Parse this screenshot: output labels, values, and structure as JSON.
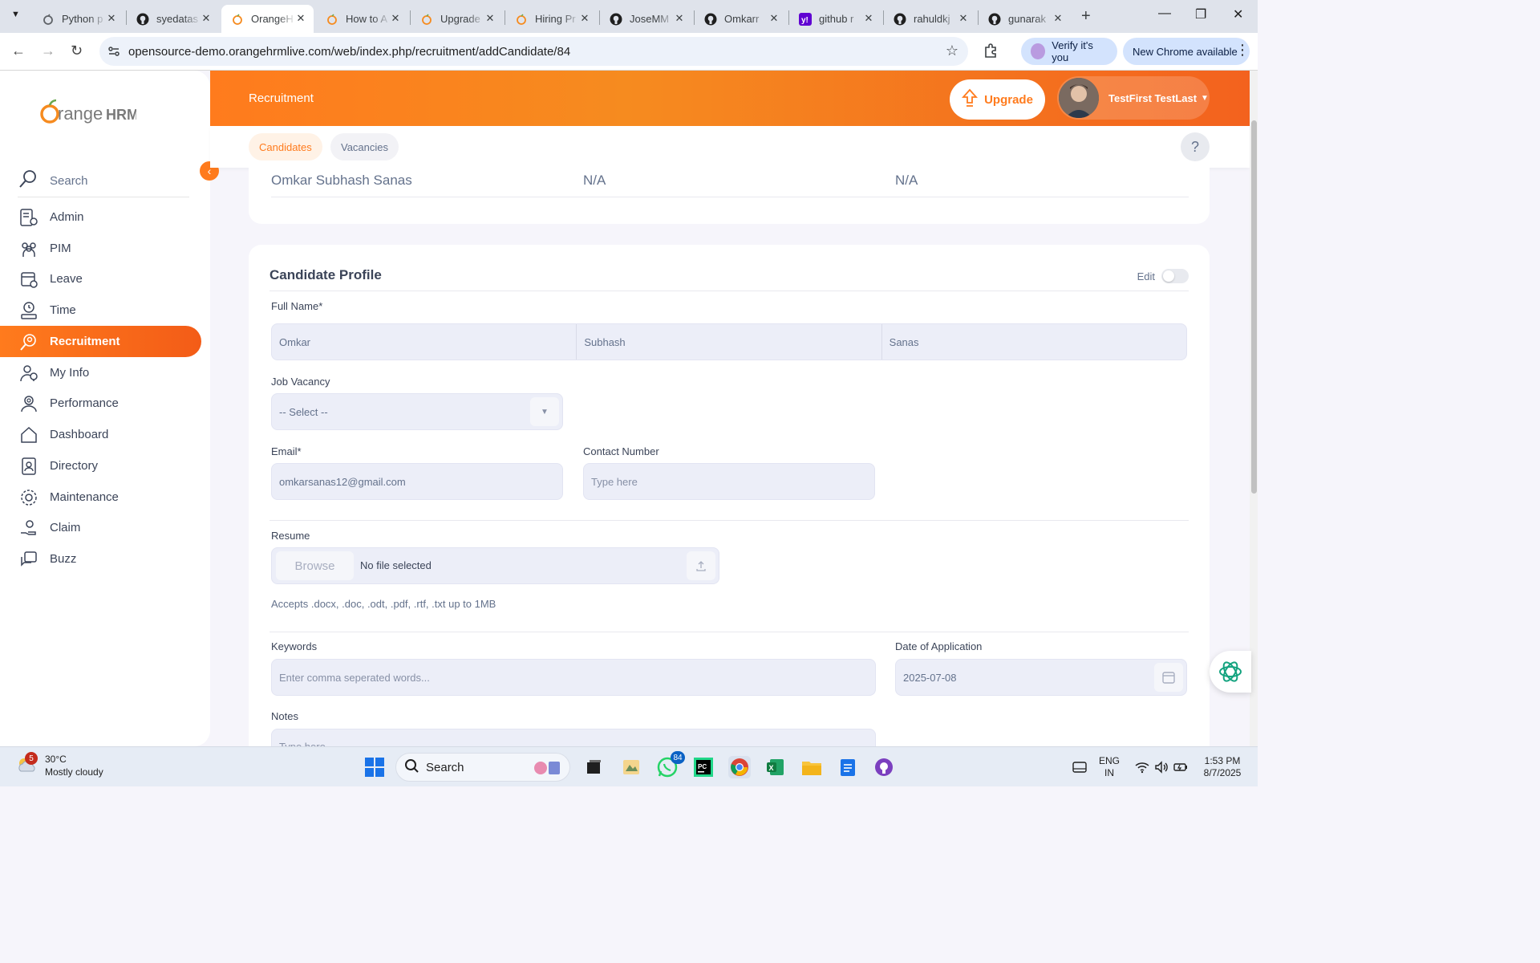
{
  "browser": {
    "tabs": [
      {
        "label": "Python p",
        "icon": "orangehrm-icon"
      },
      {
        "label": "syedatas",
        "icon": "github-icon"
      },
      {
        "label": "OrangeH",
        "icon": "orangehrm-icon",
        "active": true
      },
      {
        "label": "How to A",
        "icon": "orangehrm-icon"
      },
      {
        "label": "Upgrade",
        "icon": "orangehrm-icon"
      },
      {
        "label": "Hiring Pr",
        "icon": "orangehrm-icon"
      },
      {
        "label": "JoseMM",
        "icon": "github-icon"
      },
      {
        "label": "Omkarr",
        "icon": "github-icon"
      },
      {
        "label": "github r",
        "icon": "yahoo-icon"
      },
      {
        "label": "rahuldkj",
        "icon": "github-icon"
      },
      {
        "label": "gunarak",
        "icon": "github-icon"
      }
    ],
    "url": "opensource-demo.orangehrmlive.com/web/index.php/recruitment/addCandidate/84",
    "verify_label": "Verify it's you",
    "update_label": "New Chrome available"
  },
  "header": {
    "title": "Recruitment",
    "upgrade_label": "Upgrade",
    "user_name": "TestFirst TestLast"
  },
  "subnav": {
    "tabs": [
      "Candidates",
      "Vacancies"
    ],
    "help": "?"
  },
  "sidebar": {
    "search_label": "Search",
    "items": [
      {
        "label": "Admin",
        "icon": "admin-icon"
      },
      {
        "label": "PIM",
        "icon": "pim-icon"
      },
      {
        "label": "Leave",
        "icon": "leave-icon"
      },
      {
        "label": "Time",
        "icon": "time-icon"
      },
      {
        "label": "Recruitment",
        "icon": "recruitment-icon",
        "active": true
      },
      {
        "label": "My Info",
        "icon": "my-info-icon"
      },
      {
        "label": "Performance",
        "icon": "performance-icon"
      },
      {
        "label": "Dashboard",
        "icon": "dashboard-icon"
      },
      {
        "label": "Directory",
        "icon": "directory-icon"
      },
      {
        "label": "Maintenance",
        "icon": "maintenance-icon"
      },
      {
        "label": "Claim",
        "icon": "claim-icon"
      },
      {
        "label": "Buzz",
        "icon": "buzz-icon"
      }
    ]
  },
  "application_row": {
    "name": "Omkar Subhash Sanas",
    "col2": "N/A",
    "col3": "N/A"
  },
  "profile": {
    "title": "Candidate Profile",
    "edit_label": "Edit",
    "edit_enabled": false,
    "full_name_label": "Full Name*",
    "first_name": "Omkar",
    "middle_name": "Subhash",
    "last_name": "Sanas",
    "vacancy_label": "Job Vacancy",
    "vacancy_value": "-- Select --",
    "email_label": "Email*",
    "email_value": "omkarsanas12@gmail.com",
    "contact_label": "Contact Number",
    "contact_placeholder": "Type here",
    "resume_label": "Resume",
    "browse_label": "Browse",
    "no_file_label": "No file selected",
    "resume_hint": "Accepts .docx, .doc, .odt, .pdf, .rtf, .txt up to 1MB",
    "keywords_label": "Keywords",
    "keywords_placeholder": "Enter comma seperated words...",
    "date_label": "Date of Application",
    "date_value": "2025-07-08",
    "notes_label": "Notes",
    "notes_placeholder": "Type here"
  },
  "taskbar": {
    "weather_badge": "5",
    "temperature": "30°C",
    "condition": "Mostly cloudy",
    "search_label": "Search",
    "whatsapp_badge": "84",
    "language_line1": "ENG",
    "language_line2": "IN",
    "time": "1:53 PM",
    "date": "8/7/2025"
  },
  "colors": {
    "accent": "#ff7b1d",
    "accent_dark": "#f35c17",
    "text": "#64728c",
    "field_bg": "#eceef8"
  }
}
